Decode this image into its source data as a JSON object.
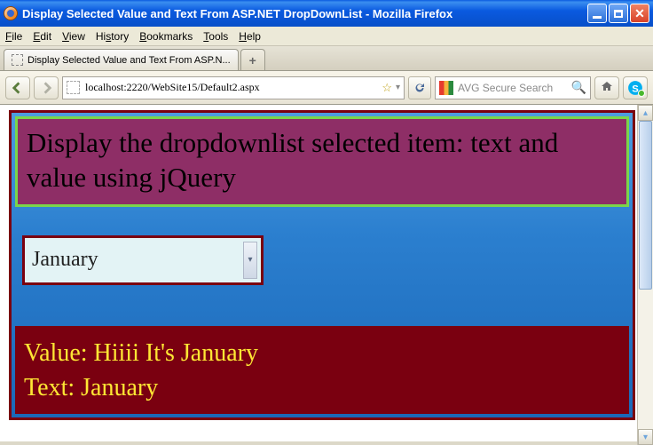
{
  "window": {
    "title": "Display Selected Value and Text From ASP.NET DropDownList - Mozilla Firefox"
  },
  "menu": {
    "file": "File",
    "edit": "Edit",
    "view": "View",
    "history": "History",
    "bookmarks": "Bookmarks",
    "tools": "Tools",
    "help": "Help"
  },
  "tab": {
    "label": "Display Selected Value and Text From ASP.N...",
    "newtab": "+"
  },
  "nav": {
    "url": "localhost:2220/WebSite15/Default2.aspx",
    "search_placeholder": "AVG Secure Search"
  },
  "page": {
    "heading": "Display the dropdownlist selected item: text and value using jQuery",
    "dropdown": {
      "selected": "January"
    },
    "result": {
      "value_label": "Value:",
      "value": "Hiiii It's January",
      "text_label": "Text:",
      "text": "January"
    }
  }
}
